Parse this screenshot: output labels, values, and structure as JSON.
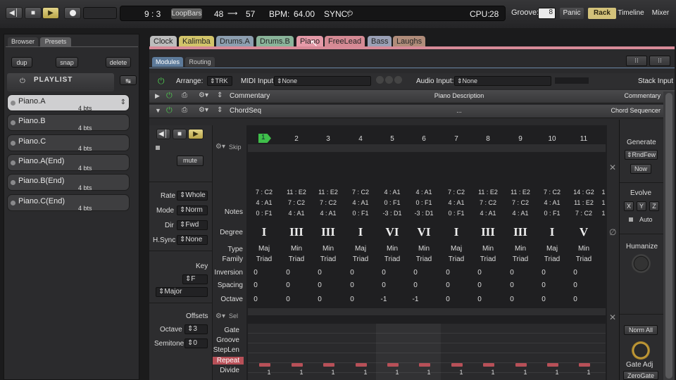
{
  "transport": {
    "position": "9 : 3",
    "loopbars": "LoopBars",
    "loop_start": "48",
    "loop_end": "57",
    "bpm_label": "BPM:",
    "bpm": "64.00",
    "sync_label": "SYNC:"
  },
  "right_top": {
    "cpu_label": "CPU:",
    "cpu": "28",
    "groove_label": "Groove:",
    "groove": "8",
    "panic": "Panic",
    "rack": "Rack",
    "timeline": "Timeline",
    "mixer": "Mixer"
  },
  "left": {
    "tabs": [
      "Browser",
      "Presets"
    ],
    "buttons": [
      "dup",
      "snap",
      "delete"
    ],
    "playlist_title": "Playlist",
    "items": [
      {
        "name": "Piano.A",
        "beats": "4 bts"
      },
      {
        "name": "Piano.B",
        "beats": "4 bts"
      },
      {
        "name": "Piano.C",
        "beats": "4 bts"
      },
      {
        "name": "Piano.A(End)",
        "beats": "4 bts"
      },
      {
        "name": "Piano.B(End)",
        "beats": "4 bts"
      },
      {
        "name": "Piano.C(End)",
        "beats": "4 bts"
      }
    ]
  },
  "part_tabs": [
    {
      "label": "Clock",
      "color": "#bdbdbd"
    },
    {
      "label": "Kalimba",
      "color": "#d2c46a"
    },
    {
      "label": "Drums.A",
      "color": "#8d9fb0"
    },
    {
      "label": "Drums.B",
      "color": "#8ab49a"
    },
    {
      "label": "Piano",
      "color": "#e59aa8"
    },
    {
      "label": "FreeLead",
      "color": "#d58a94"
    },
    {
      "label": "Bass",
      "color": "#9aa0b5"
    },
    {
      "label": "Laughs",
      "color": "#b08c7a"
    }
  ],
  "module_tabs": [
    "Modules",
    "Routing"
  ],
  "arrange": {
    "label": "Arrange:",
    "value": "TRK",
    "midi_label": "MIDI Input:",
    "midi_value": "None",
    "audio_label": "Audio Input:",
    "audio_value": "None",
    "stack": "Stack Input"
  },
  "modules": [
    {
      "name": "Commentary",
      "desc": "Piano Description",
      "type": "Commentary"
    },
    {
      "name": "ChordSeq",
      "desc": "...",
      "type": "Chord Sequencer"
    }
  ],
  "seq": {
    "skip": "Skip",
    "mute": "mute",
    "sel": "Sel",
    "columns": [
      "1",
      "2",
      "3",
      "4",
      "5",
      "6",
      "7",
      "8",
      "9",
      "10",
      "11"
    ],
    "notes": [
      [
        "7 : C2",
        "4 : A1",
        "0 : F1"
      ],
      [
        "11 : E2",
        "7 : C2",
        "4 : A1"
      ],
      [
        "11 : E2",
        "7 : C2",
        "4 : A1"
      ],
      [
        "7 : C2",
        "4 : A1",
        "0 : F1"
      ],
      [
        "4 : A1",
        "0 : F1",
        "-3 : D1"
      ],
      [
        "4 : A1",
        "0 : F1",
        "-3 : D1"
      ],
      [
        "7 : C2",
        "4 : A1",
        "0 : F1"
      ],
      [
        "11 : E2",
        "7 : C2",
        "4 : A1"
      ],
      [
        "11 : E2",
        "7 : C2",
        "4 : A1"
      ],
      [
        "7 : C2",
        "4 : A1",
        "0 : F1"
      ],
      [
        "14 : G2",
        "11 : E2",
        "7 : C2"
      ]
    ],
    "partial_col": [
      "1",
      "1",
      "1"
    ],
    "degrees": [
      "I",
      "III",
      "III",
      "I",
      "VI",
      "VI",
      "I",
      "III",
      "III",
      "I",
      "V"
    ],
    "types": [
      "Maj",
      "Min",
      "Min",
      "Maj",
      "Min",
      "Min",
      "Maj",
      "Min",
      "Min",
      "Maj",
      "Min"
    ],
    "families": [
      "Triad",
      "Triad",
      "Triad",
      "Triad",
      "Triad",
      "Triad",
      "Triad",
      "Triad",
      "Triad",
      "Triad",
      "Triad"
    ],
    "inversion": [
      "0",
      "0",
      "0",
      "0",
      "0",
      "0",
      "0",
      "0",
      "0",
      "0",
      "0"
    ],
    "spacing": [
      "0",
      "0",
      "0",
      "0",
      "0",
      "0",
      "0",
      "0",
      "0",
      "0",
      "0"
    ],
    "octave": [
      "0",
      "0",
      "0",
      "0",
      "-1",
      "-1",
      "0",
      "0",
      "0",
      "0",
      "0"
    ],
    "row_labels": {
      "notes": "Notes",
      "degree": "Degree",
      "type": "Type",
      "family": "Family",
      "inversion": "Inversion",
      "spacing": "Spacing",
      "octave": "Octave"
    },
    "lower_rows": [
      "Gate",
      "Groove",
      "StepLen",
      "Repeat",
      "Divide"
    ],
    "lower_values": [
      "1",
      "1",
      "1",
      "1",
      "1",
      "1",
      "1",
      "1",
      "1",
      "1",
      "1"
    ]
  },
  "left_params": {
    "rate_label": "Rate",
    "rate": "Whole",
    "mode_label": "Mode",
    "mode": "Norm",
    "dir_label": "Dir",
    "dir": "Fwd",
    "hsync_label": "H.Sync",
    "hsync": "None",
    "key_label": "Key",
    "key": "F",
    "scale": "Major",
    "offsets_label": "Offsets",
    "octave_label": "Octave",
    "octave": "3",
    "semitone_label": "Semitone",
    "semitone": "0"
  },
  "right_panel": {
    "generate": "Generate",
    "rndfew": "RndFew",
    "now": "Now",
    "evolve": "Evolve",
    "x": "X",
    "y": "Y",
    "z": "Z",
    "auto": "Auto",
    "humanize": "Humanize",
    "norm_all": "Norm All",
    "gate_adj": "Gate Adj",
    "zerogate": "ZeroGate"
  },
  "colors": {
    "accent": "#d3c27a",
    "piano_tab": "#e59aa8",
    "repeat": "#b85058",
    "power": "#4ec24e",
    "skip_marker": "#3fbf4a"
  }
}
